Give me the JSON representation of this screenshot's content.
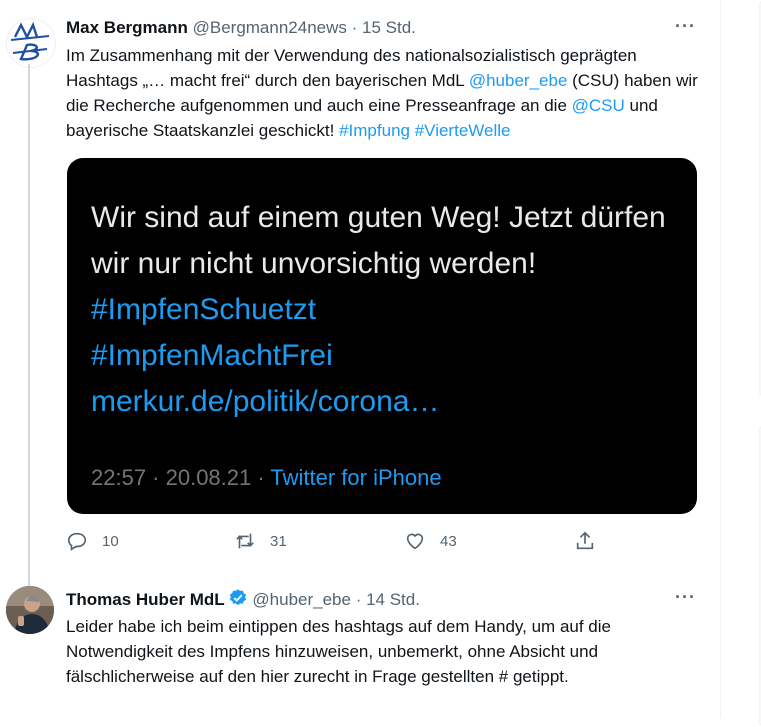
{
  "tweet1": {
    "display_name": "Max Bergmann",
    "handle": "@Bergmann24news",
    "time": "15 Std.",
    "separator": " · ",
    "more": "···",
    "text": {
      "t1": "Im Zusammenhang mit der Verwendung des nationalsozialistisch geprägten Hashtags „… macht frei“ durch den bayerischen MdL ",
      "mention1": "@huber_ebe",
      "t2": " (CSU) haben wir die Recherche aufgenommen und auch eine Presseanfrage an die ",
      "mention2": "@CSU",
      "t3": " und bayerische Staatskanzlei geschickt! ",
      "hashtag1": "#Impfung",
      "hashtag2": "#VierteWelle"
    },
    "media": {
      "line_text": "Wir sind auf einem guten Weg! Jetzt dürfen wir nur nicht unvorsichtig werden! ",
      "hashtag1": "#ImpfenSchuetzt",
      "hashtag2": "#ImpfenMachtFrei",
      "link": "merkur.de/politik/corona…",
      "timestamp": "22:57 · 20.08.21 · ",
      "client": "Twitter for iPhone"
    },
    "actions": {
      "replies": "10",
      "retweets": "31",
      "likes": "43"
    }
  },
  "tweet2": {
    "display_name": "Thomas Huber MdL",
    "handle": "@huber_ebe",
    "time": "14 Std.",
    "separator": " · ",
    "more": "···",
    "text": "Leider habe ich beim eintippen des hashtags auf dem Handy, um auf die Notwendigkeit  des Impfens hinzuweisen, unbemerkt, ohne Absicht und fälschlicherweise auf den hier zurecht in Frage gestellten # getippt."
  },
  "colors": {
    "accent": "#1d9bf0",
    "secondary_text": "#536471",
    "media_bg": "#000000"
  }
}
